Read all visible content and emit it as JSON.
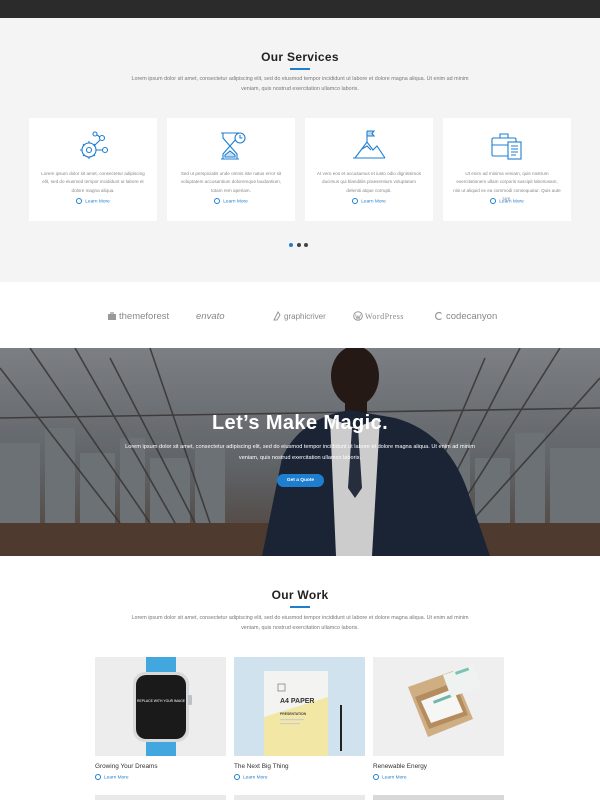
{
  "services": {
    "title": "Our Services",
    "subtitle": "Lorem ipsum dolor sit amet, consectetur adipiscing elit, sed do eiusmod tempor incididunt ut labore et dolore magna aliqua. Ut enim ad minim veniam, quis nostrud exercitation ullamco laboris.",
    "cards": [
      {
        "icon": "gears-network-icon",
        "text": "Lorem ipsum dolor sit amet, consectetur adipiscing elit, sed do eiusmod tempor incididunt ut labore et dolore magna aliqua.",
        "link": "Learn More"
      },
      {
        "icon": "hourglass-clock-icon",
        "text": "Sed ut perspiciatis unde omnis iste natus error sit voluptatem accusantium doloremque laudantium, totam rem aperiam.",
        "link": "Learn More"
      },
      {
        "icon": "mountain-flag-icon",
        "text": "At vero eos et accusamus et iusto odio dignissimos ducimus qui blanditiis praesentium voluptatum deleniti atque corrupti.",
        "link": "Learn More"
      },
      {
        "icon": "briefcase-document-icon",
        "text": "Ut enim ad minima veniam, quis nostrum exercitationem ullam corporis suscipit laboriosam, nisi ut aliquid ex ea commodi consequatur. Quis aute iure.",
        "link": "Learn More"
      }
    ],
    "active_slide": 1,
    "slide_count": 3
  },
  "partners": [
    {
      "name": "themeforest",
      "icon": "themeforest-logo-icon"
    },
    {
      "name": "envato",
      "icon": "envato-logo-icon"
    },
    {
      "name": "graphicriver",
      "icon": "graphicriver-logo-icon"
    },
    {
      "name": "WordPress",
      "icon": "wordpress-logo-icon"
    },
    {
      "name": "codecanyon",
      "icon": "codecanyon-logo-icon"
    }
  ],
  "hero": {
    "title": "Let’s Make Magic.",
    "subtitle": "Lorem ipsum dolor sit amet, consectetur adipiscing elit, sed do eiusmod tempor incididunt ut labore et dolore magna aliqua. Ut enim ad minim veniam, quis nostrud exercitation ullamco laboris.",
    "button": "Get a Quote"
  },
  "work": {
    "title": "Our Work",
    "subtitle": "Lorem ipsum dolor sit amet, consectetur adipiscing elit, sed do eiusmod tempor incididunt ut labore et dolore magna aliqua. Ut enim ad minim veniam, quis nostrud exercitation ullamco laboris.",
    "items": [
      {
        "title": "Growing Your Dreams",
        "link": "Learn More",
        "watch_text": "REPLACE WITH YOUR IMAGE"
      },
      {
        "title": "The Next Big Thing",
        "link": "Learn More",
        "paper_title": "A4 PAPER",
        "paper_sub": "PRESENTATION"
      },
      {
        "title": "Renewable Energy",
        "link": "Learn More"
      }
    ]
  },
  "colors": {
    "accent": "#1e7fd1",
    "topbar": "#2b2b2b",
    "section_bg": "#f4f4f4"
  }
}
